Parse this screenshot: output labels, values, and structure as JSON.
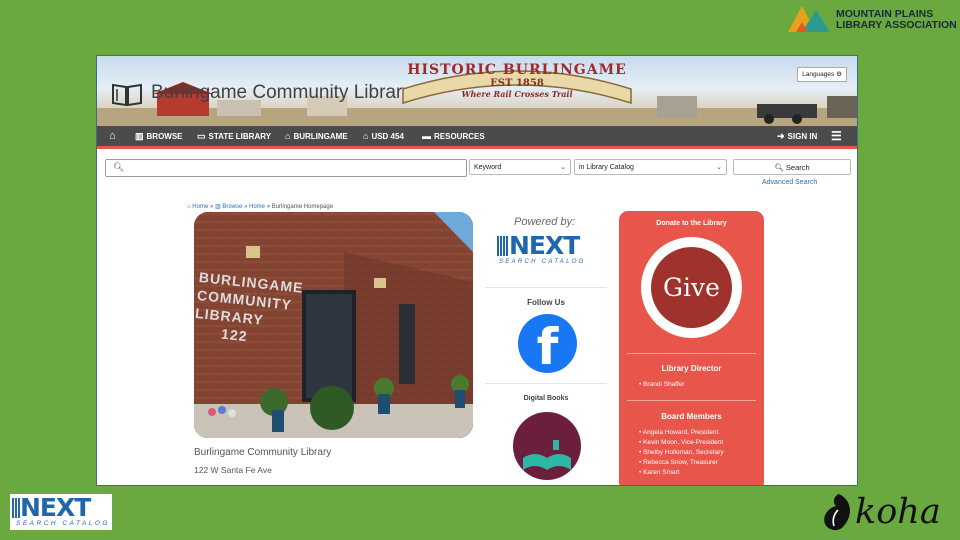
{
  "brands": {
    "mpla_line1": "MOUNTAIN PLAINS",
    "mpla_line2": "LIBRARY ASSOCIATION",
    "next_word": "NEXT",
    "next_sub": "SEARCH CATALOG",
    "koha": "koha"
  },
  "banner": {
    "title": "Burlingame Community Library",
    "arch_line1": "HISTORIC BURLINGAME",
    "arch_line2": "EST 1858",
    "arch_line3": "Where Rail Crosses Trail",
    "languages": "Languages ⚙"
  },
  "nav": {
    "browse": "BROWSE",
    "state_library": "STATE LIBRARY",
    "burlingame": "BURLINGAME",
    "usd": "USD 454",
    "resources": "RESOURCES",
    "sign_in": "SIGN IN"
  },
  "search": {
    "query": "",
    "field": "Keyword",
    "scope": "in Library Catalog",
    "button": "Search",
    "advanced": "Advanced Search"
  },
  "breadcrumb": {
    "home": "Home",
    "browse": "Browse",
    "home2": "Home",
    "current": "Burlingame Homepage"
  },
  "photo_sign": [
    "BURLINGAME",
    "COMMUNITY",
    "LIBRARY",
    "122"
  ],
  "library": {
    "name": "Burlingame Community Library",
    "address": "122 W Santa Fe Ave"
  },
  "middle": {
    "powered_by": "Powered by:",
    "next_word": "NEXT",
    "next_sub": "SEARCH CATALOG",
    "follow_us": "Follow Us",
    "facebook": "f",
    "digital_books": "Digital Books"
  },
  "donate": {
    "heading": "Donate to the Library",
    "give": "Give",
    "director_heading": "Library Director",
    "director": "Brandi Shaffer",
    "board_heading": "Board Members",
    "board": [
      "Angela Howard, President",
      "Kevin Moon, Vice-President",
      "Shelby Holloman, Secretary",
      "Rebecca Snow, Treasurer",
      "Karen Smart"
    ]
  },
  "colors": {
    "slide_bg": "#69a93f",
    "navbar": "#4b4b4b",
    "accent": "#e8564b",
    "next_blue": "#1f66ad",
    "facebook": "#1877f2"
  }
}
